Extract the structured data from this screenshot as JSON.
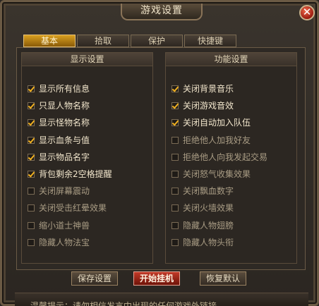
{
  "window": {
    "title": "游戏设置",
    "close_symbol": "✕"
  },
  "tabs": [
    {
      "label": "基本",
      "active": true
    },
    {
      "label": "拾取",
      "active": false
    },
    {
      "label": "保护",
      "active": false
    },
    {
      "label": "快捷键",
      "active": false
    }
  ],
  "display_settings": {
    "header": "显示设置",
    "options": [
      {
        "label": "显示所有信息",
        "checked": true
      },
      {
        "label": "只显人物名称",
        "checked": true
      },
      {
        "label": "显示怪物名称",
        "checked": true
      },
      {
        "label": "显示血条与值",
        "checked": true
      },
      {
        "label": "显示物品名字",
        "checked": true
      },
      {
        "label": "背包剩余2空格提醒",
        "checked": true
      },
      {
        "label": "关闭屏幕震动",
        "checked": false
      },
      {
        "label": "关闭受击红晕效果",
        "checked": false
      },
      {
        "label": "缩小道士神兽",
        "checked": false
      },
      {
        "label": "隐藏人物法宝",
        "checked": false
      }
    ]
  },
  "function_settings": {
    "header": "功能设置",
    "options": [
      {
        "label": "关闭背景音乐",
        "checked": true
      },
      {
        "label": "关闭游戏音效",
        "checked": true
      },
      {
        "label": "关闭自动加入队伍",
        "checked": true
      },
      {
        "label": "拒绝他人加我好友",
        "checked": false
      },
      {
        "label": "拒绝他人向我发起交易",
        "checked": false
      },
      {
        "label": "关闭怒气收集效果",
        "checked": false
      },
      {
        "label": "关闭飘血数字",
        "checked": false
      },
      {
        "label": "关闭火墙效果",
        "checked": false
      },
      {
        "label": "隐藏人物翅膀",
        "checked": false
      },
      {
        "label": "隐藏人物头衔",
        "checked": false
      }
    ]
  },
  "buttons": {
    "save": "保存设置",
    "start": "开始挂机",
    "restore": "恢复默认"
  },
  "footer": {
    "text": "温馨提示：请勿相信发言中出现的任何游戏外链接"
  }
}
